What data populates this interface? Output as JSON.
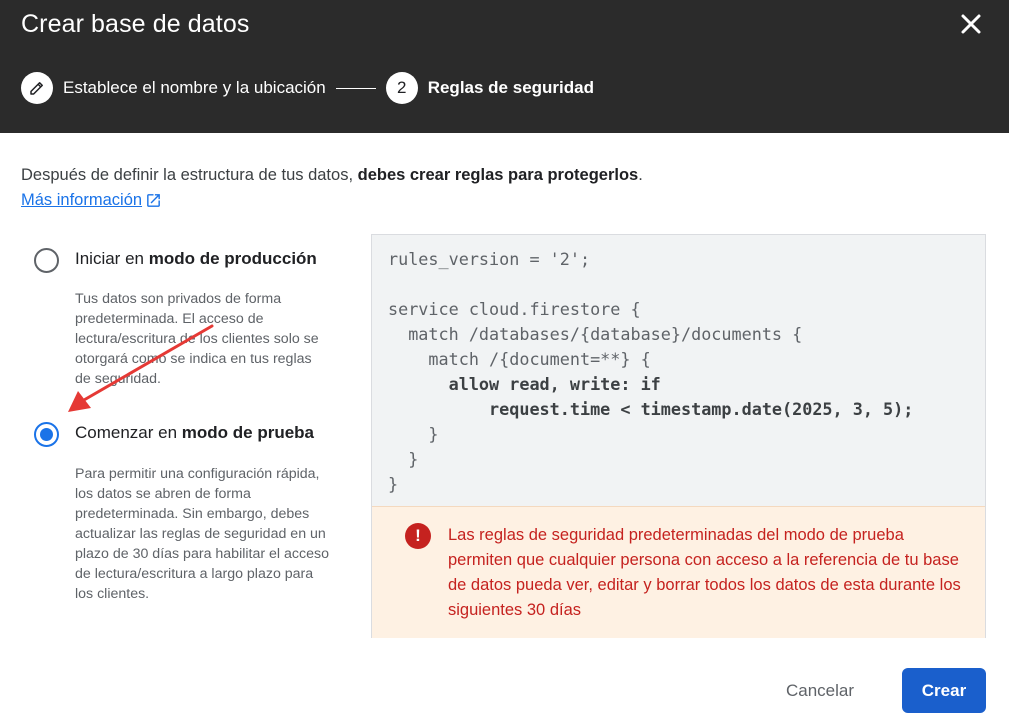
{
  "dialog": {
    "title": "Crear base de datos",
    "close_icon": "close-icon"
  },
  "stepper": {
    "steps": [
      {
        "label": "Establece el nombre y la ubicación",
        "state": "completed",
        "icon": "pencil-icon"
      },
      {
        "label": "Reglas de seguridad",
        "state": "active",
        "number": "2"
      }
    ]
  },
  "intro": {
    "text_plain": "Después de definir la estructura de tus datos, ",
    "text_bold": "debes crear reglas para protegerlos",
    "text_end": ".",
    "learn_more": "Más información",
    "learn_more_icon": "open-in-new-icon"
  },
  "options": [
    {
      "title_plain": "Iniciar en ",
      "title_bold": "modo de producción",
      "description": "Tus datos son privados de forma predeterminada. El acceso de lectura/escritura de los clientes solo se otorgará como se indica en tus reglas de seguridad.",
      "selected": false
    },
    {
      "title_plain": "Comenzar en ",
      "title_bold": "modo de prueba",
      "description": "Para permitir una configuración rápida, los datos se abren de forma predeterminada. Sin embargo, debes actualizar las reglas de seguridad en un plazo de 30 días para habilitar el acceso de lectura/escritura a largo plazo para los clientes.",
      "selected": true
    }
  ],
  "code": {
    "lines": [
      "rules_version = '2';",
      "",
      "service cloud.firestore {",
      "  match /databases/{database}/documents {",
      "    match /{document=**} {",
      "      allow read, write: if",
      "          request.time < timestamp.date(2025, 3, 5);",
      "    }",
      "  }",
      "}"
    ]
  },
  "warning": {
    "icon": "error-icon",
    "icon_glyph": "!",
    "text": "Las reglas de seguridad predeterminadas del modo de prueba permiten que cualquier persona con acceso a la referencia de tu base de datos pueda ver, editar y borrar todos los datos de esta durante los siguientes 30 días"
  },
  "actions": {
    "cancel": "Cancelar",
    "create": "Crear"
  },
  "colors": {
    "header_bg": "#2b2b2b",
    "accent": "#1a73e8",
    "warning_text": "#c5221f",
    "warning_bg": "#fef1e3",
    "annotation_arrow": "#e53935"
  }
}
